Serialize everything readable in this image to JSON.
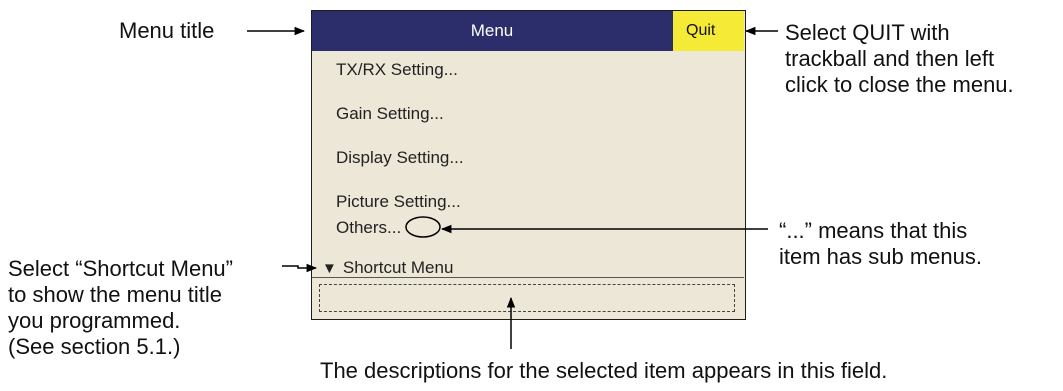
{
  "callouts": {
    "menu_title": "Menu title",
    "quit_instruction": "Select QUIT with\ntrackball and then left\nclick to close the menu.",
    "ellipsis_note": "“...” means that this\nitem has sub menus.",
    "shortcut_instruction": "Select “Shortcut Menu”\nto show the menu title\nyou  programmed.\n(See section 5.1.)",
    "description_note": "The descriptions for the selected item appears in this field."
  },
  "menu": {
    "title": "Menu",
    "quit_label": "Quit",
    "items": [
      {
        "label": "TX/RX Setting..."
      },
      {
        "label": "Gain Setting..."
      },
      {
        "label": "Display Setting..."
      },
      {
        "label": "Picture Setting..."
      },
      {
        "label": "Others..."
      }
    ],
    "shortcut_label": "Shortcut Menu"
  },
  "colors": {
    "header": "#2c2e6b",
    "quit": "#f5ea35",
    "panel": "#ece7d7"
  }
}
